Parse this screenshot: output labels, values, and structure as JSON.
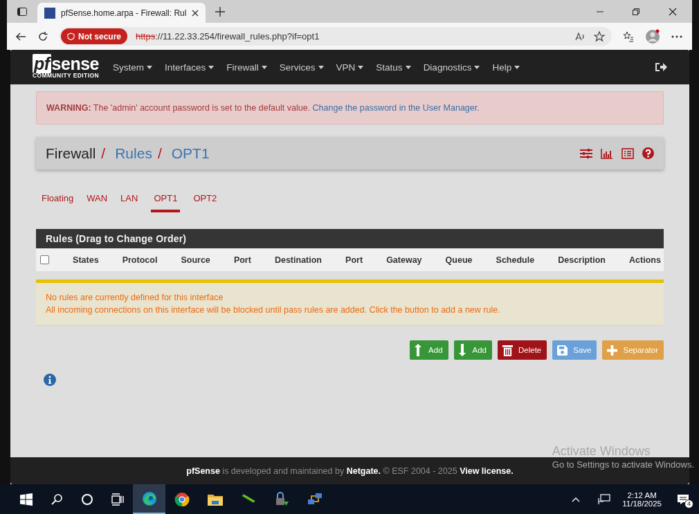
{
  "browser": {
    "tab_title": "pfSense.home.arpa - Firewall: Rul",
    "security_badge": "Not secure",
    "url_scheme": "https",
    "url_rest": "://11.22.33.254/firewall_rules.php?if=opt1"
  },
  "navbar": {
    "logo": "sense",
    "logo_prefix": "pf",
    "edition": "COMMUNITY EDITION",
    "menus": [
      "System",
      "Interfaces",
      "Firewall",
      "Services",
      "VPN",
      "Status",
      "Diagnostics",
      "Help"
    ]
  },
  "warning": {
    "label": "WARNING:",
    "text": "The 'admin' account password is set to the default value.",
    "link": "Change the password in the User Manager."
  },
  "breadcrumb": [
    {
      "text": "Firewall",
      "link": false,
      "separator": "/"
    },
    {
      "text": "Rules",
      "link": true,
      "separator": "/"
    },
    {
      "text": "OPT1",
      "link": true
    }
  ],
  "tabs": [
    {
      "label": "Floating",
      "selected": false
    },
    {
      "label": "WAN",
      "selected": false
    },
    {
      "label": "LAN",
      "selected": false
    },
    {
      "label": "OPT1",
      "selected": true
    },
    {
      "label": "OPT2",
      "selected": false
    }
  ],
  "table": {
    "title": "Rules (Drag to Change Order)",
    "select_all_checked": false,
    "columns": [
      "States",
      "Protocol",
      "Source",
      "Port",
      "Destination",
      "Port",
      "Gateway",
      "Queue",
      "Schedule",
      "Description",
      "Actions"
    ]
  },
  "notice": [
    "No rules are currently defined for this interface",
    "All incoming connections on this interface will be blocked until pass rules are added. Click the button to add a new rule."
  ],
  "buttons": [
    {
      "kind": "add-top",
      "label": "Add"
    },
    {
      "kind": "add-bottom",
      "label": "Add"
    },
    {
      "kind": "delete",
      "label": "Delete"
    },
    {
      "kind": "save",
      "label": "Save"
    },
    {
      "kind": "separator",
      "label": "Separator"
    }
  ],
  "footer": {
    "brand": "pfSense",
    "middle": "is developed and maintained by",
    "company": "Netgate.",
    "copyright": "© ESF 2004 - 2025",
    "license": "View license."
  },
  "activation": {
    "title": "Activate Windows",
    "hint": "Go to Settings to activate Windows."
  },
  "taskbar": {
    "time": "2:12 AM",
    "date": "11/18/2025",
    "notifications": "4"
  }
}
